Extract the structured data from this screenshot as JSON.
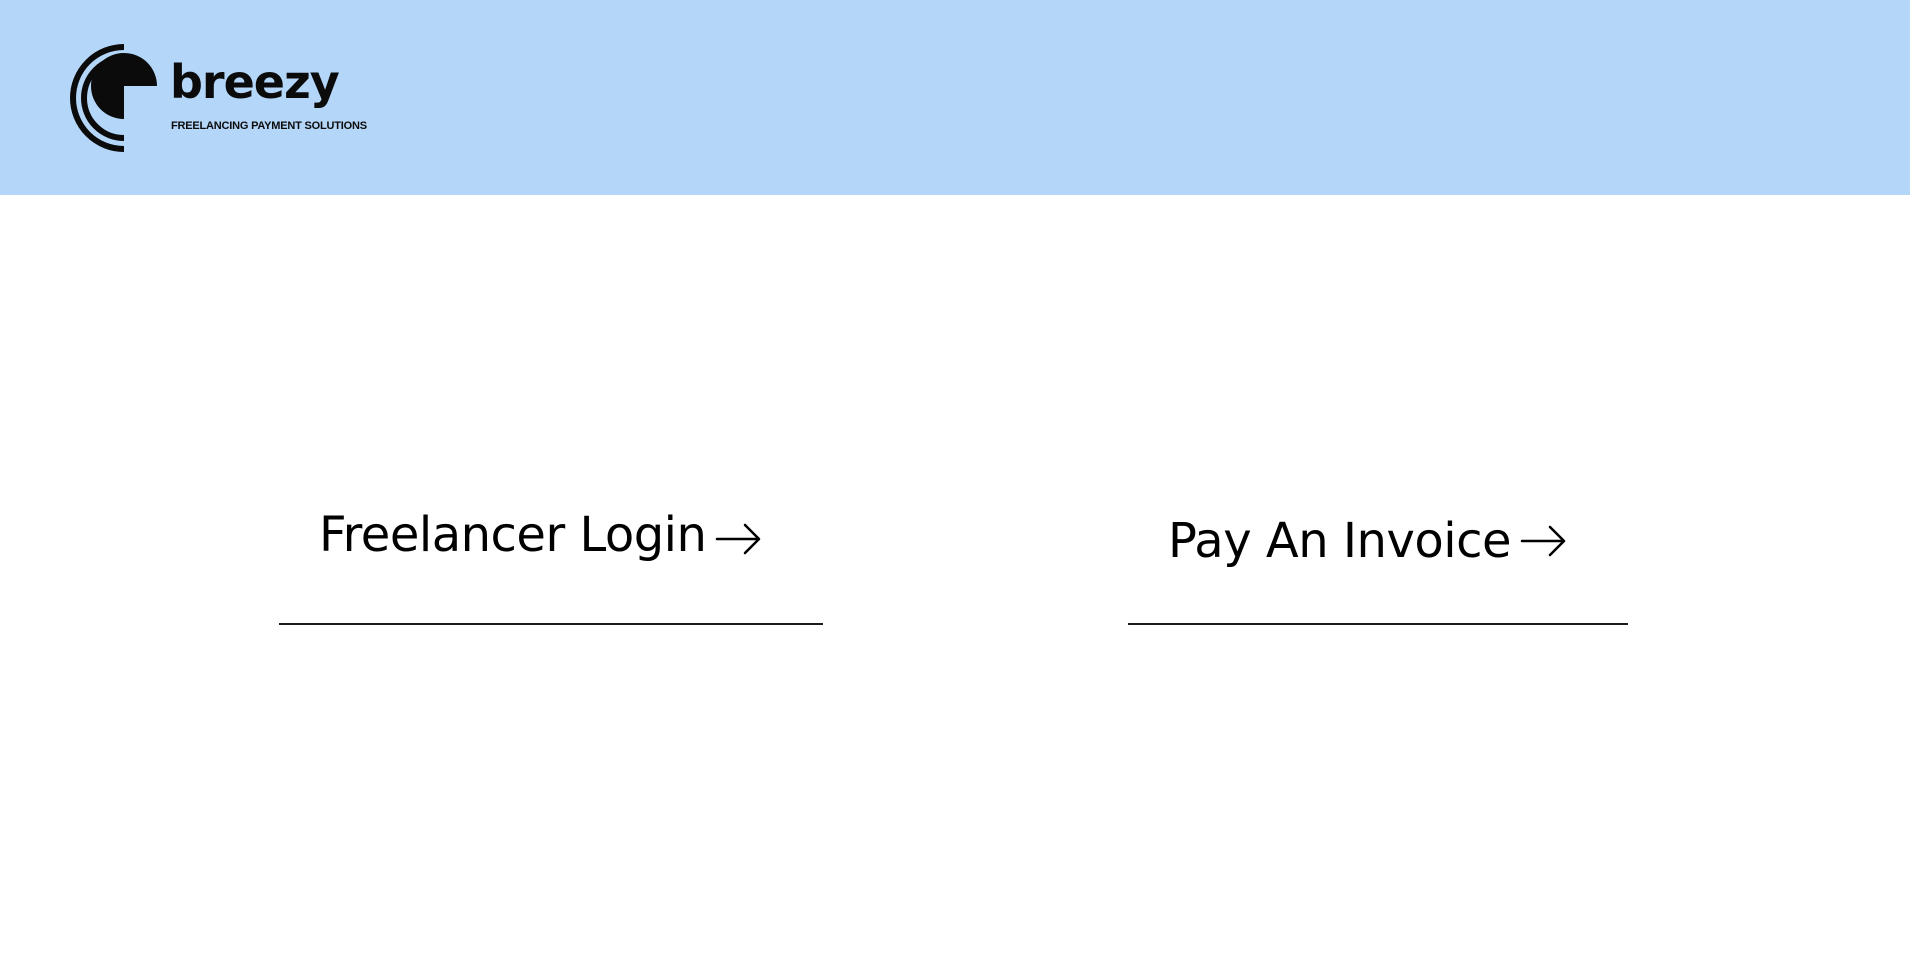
{
  "brand": {
    "name": "breezy",
    "tagline": "FREELANCING PAYMENT SOLUTIONS",
    "header_color": "#b3d6f9",
    "logo_icon": "breezy-c-arcs-logo"
  },
  "actions": [
    {
      "label": "Freelancer Login",
      "icon": "arrow-right-icon"
    },
    {
      "label": "Pay An Invoice",
      "icon": "arrow-right-icon"
    }
  ]
}
